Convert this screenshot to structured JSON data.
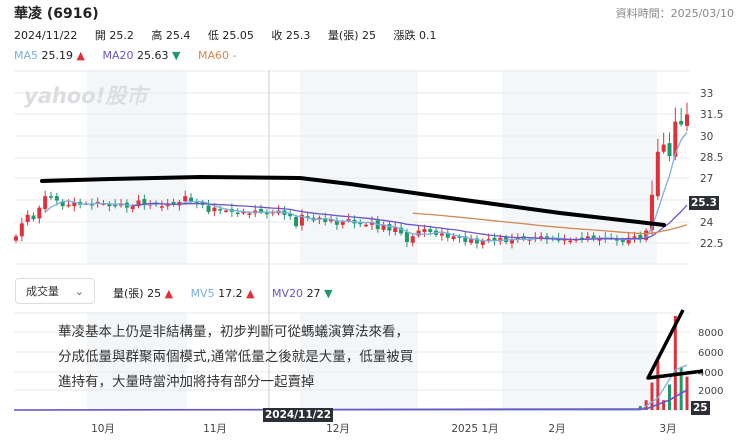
{
  "header": {
    "title": "華凌 (6916)",
    "data_time": "資料時間：2025/03/10"
  },
  "quote": {
    "date": "2024/11/22",
    "open_label": "開",
    "open": "25.2",
    "high_label": "高",
    "high": "25.4",
    "low_label": "低",
    "low": "25.05",
    "close_label": "收",
    "close": "25.3",
    "vol_label": "量(張)",
    "vol": "25",
    "chg_label": "漲跌",
    "chg": "0.1"
  },
  "ma": {
    "ma5_label": "MA5",
    "ma5": "25.19",
    "ma5_dir": "▲",
    "ma20_label": "MA20",
    "ma20": "25.63",
    "ma20_dir": "▼",
    "ma60_label": "MA60",
    "ma60": "-"
  },
  "watermark": "yahoo!股市",
  "volume_panel": {
    "dropdown": "成交量",
    "vol_label": "量(張)",
    "vol": "25",
    "vol_dir": "▲",
    "mv5_label": "MV5",
    "mv5": "17.2",
    "mv5_dir": "▲",
    "mv20_label": "MV20",
    "mv20": "27",
    "mv20_dir": "▼"
  },
  "note_text": "華凌基本上仍是非結構量，初步判斷可從螞蟻演算法來看，分成低量與群聚兩個模式,通常低量之後就是大量，低量被買進持有，大量時當沖加將持有部分一起賣掉",
  "crosshair_date": "2024/11/22",
  "price_badge": "25.3",
  "volume_badge": "25",
  "colors": {
    "up": "#e0313b",
    "down": "#1e9a6a",
    "ma5": "#7cb0e0",
    "ma20": "#6a56c8",
    "ma60": "#d08a55"
  },
  "chart_data": {
    "type": "candlestick",
    "price_axis": {
      "ticks": [
        "33",
        "31.5",
        "30",
        "28.5",
        "27",
        "25.5",
        "24",
        "22.5"
      ],
      "range": [
        21.5,
        34.5
      ]
    },
    "volume_axis": {
      "ticks": [
        "8000",
        "6000",
        "4000",
        "2000"
      ],
      "range": [
        0,
        10000
      ]
    },
    "x_labels": [
      "10月",
      "11月",
      "12月",
      "2025 1月",
      "2月",
      "3月"
    ],
    "closes": [
      23.0,
      23.9,
      24.5,
      24.2,
      25.0,
      25.8,
      25.7,
      25.5,
      25.1,
      25.2,
      25.4,
      25.2,
      25.3,
      25.2,
      25.4,
      25.3,
      25.1,
      25.2,
      25.3,
      25.0,
      25.1,
      25.5,
      25.2,
      25.3,
      25.2,
      25.1,
      25.3,
      25.2,
      25.4,
      25.8,
      25.4,
      25.3,
      25.2,
      24.7,
      25.0,
      24.8,
      24.8,
      24.7,
      24.6,
      24.7,
      24.6,
      24.8,
      24.7,
      24.6,
      24.7,
      24.8,
      24.5,
      24.4,
      23.7,
      24.5,
      24.3,
      24.1,
      24.3,
      24.0,
      24.2,
      23.8,
      24.0,
      24.2,
      23.9,
      23.9,
      23.8,
      24.0,
      23.5,
      23.8,
      23.4,
      23.6,
      23.2,
      22.6,
      23.0,
      23.4,
      23.5,
      23.3,
      23.1,
      23.2,
      22.9,
      23.0,
      22.9,
      22.6,
      22.8,
      22.5,
      22.7,
      22.8,
      22.7,
      22.9,
      22.6,
      22.8,
      22.9,
      22.8,
      22.8,
      22.9,
      23.0,
      22.8,
      22.9,
      22.7,
      22.8,
      22.7,
      22.8,
      22.9,
      23.0,
      22.8,
      22.9,
      22.8,
      22.9,
      22.7,
      22.6,
      22.9,
      23.0,
      22.8,
      23.4,
      25.9,
      28.9,
      29.4,
      28.6,
      31.0,
      30.8,
      31.5
    ],
    "volumes_last": [
      400,
      1000,
      2800,
      5000,
      1000,
      2600,
      9600,
      4400,
      3400
    ]
  }
}
